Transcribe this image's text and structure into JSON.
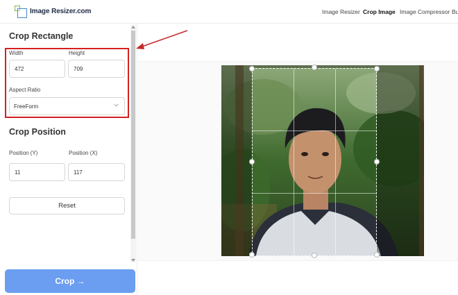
{
  "header": {
    "brand": "Image Resizer.com",
    "nav": [
      {
        "label": "Image Resizer",
        "active": false
      },
      {
        "label": "Crop Image",
        "active": true
      },
      {
        "label": "Image Compressor",
        "active": false
      },
      {
        "label": "Bu",
        "active": false
      }
    ]
  },
  "sidebar": {
    "crop_rectangle_title": "Crop Rectangle",
    "width_label": "Width",
    "width_value": "472",
    "height_label": "Height",
    "height_value": "709",
    "aspect_label": "Aspect Ratio",
    "aspect_value": "FreeForm",
    "crop_position_title": "Crop Position",
    "pos_y_label": "Position (Y)",
    "pos_y_value": "11",
    "pos_x_label": "Position (X)",
    "pos_x_value": "117",
    "reset_label": "Reset",
    "crop_label": "Crop →"
  },
  "colors": {
    "accent": "#6b9df0",
    "highlight": "#d32020"
  }
}
